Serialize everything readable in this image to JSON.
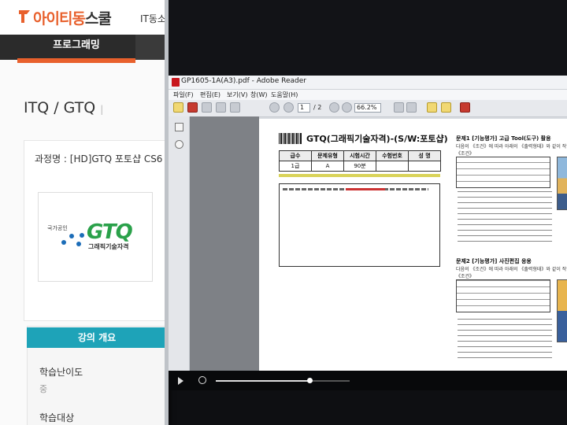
{
  "site": {
    "logo_orange": "아이티동",
    "logo_dark": "스쿨",
    "top_nav": "IT동소",
    "menu_active": "프로그래밍",
    "page_title": "ITQ / GTQ",
    "page_title_sep": "|",
    "course_name": "과정명 : [HD]GTQ 포토샵 CS6 -",
    "thumb": {
      "badge": "국가공인",
      "brand": "GTQ",
      "subtitle": "그래픽기술자격"
    },
    "section_title": "강의 개요",
    "difficulty_label": "학습난이도",
    "difficulty_value": "중",
    "target_label": "학습대상",
    "colors": {
      "accent": "#e8602c",
      "section": "#1ea3b8",
      "brand_green": "#2aa14a"
    }
  },
  "reader": {
    "window_title": "GP1605-1A(A3).pdf - Adobe Reader",
    "menu": [
      "파일(F)",
      "편집(E)",
      "보기(V)",
      "창(W)",
      "도움말(H)"
    ],
    "page_current": "1",
    "page_total": "/ 2",
    "zoom": "66.2%",
    "doc": {
      "title": "GTQ(그래픽기술자격)-(S/W:포토샵)",
      "table_headers": [
        "급수",
        "문제유형",
        "시험시간",
        "수험번호",
        "성 명"
      ],
      "table_row": [
        "1급",
        "A",
        "90분",
        "",
        ""
      ],
      "sec1_head": "문제1 [기능평가] 고급 Tool(도구) 활용",
      "sec1_sub": "다음의 《조건》에 따라 아래의 《출력형태》와 같이 작업하시오.",
      "sec1_cond": "《조건》",
      "sec2_head": "문제2 [기능평가] 사진편집 응용",
      "sec2_sub": "다음의 《조건》에 따라 아래의 《출력형태》와 같이 작업하시오.",
      "sec2_cond": "《조건》"
    }
  },
  "video": {
    "progress": 0.7
  }
}
